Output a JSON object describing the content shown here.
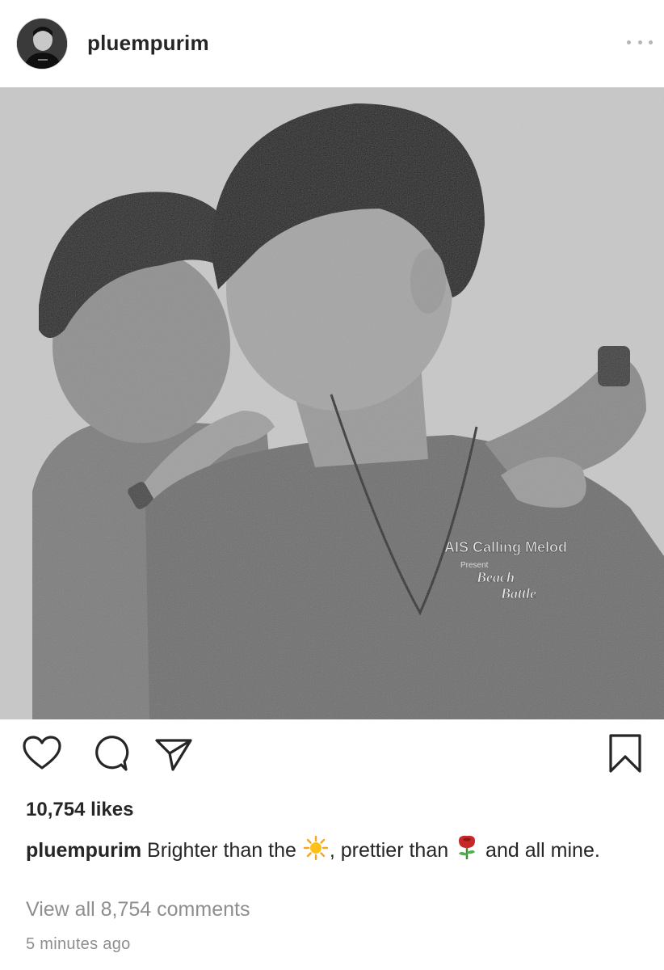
{
  "post": {
    "username": "pluempurim",
    "likes_text": "10,754 likes",
    "caption": {
      "username": "pluempurim",
      "part1": "Brighter than the",
      "emoji1": "sun-emoji",
      "part2": ", prettier than",
      "emoji2": "rose-emoji",
      "part3": "and all mine."
    },
    "view_comments_text": "View all 8,754 comments",
    "timestamp": "5 minutes ago",
    "photo_shirt_text": {
      "line1": "AIS Calling Melod",
      "line2": "Present",
      "line3": "Beach",
      "line4": "Battle"
    }
  },
  "icons": {
    "more": "more-options-icon",
    "like": "heart-icon",
    "comment": "comment-bubble-icon",
    "share": "paper-plane-icon",
    "save": "bookmark-icon"
  },
  "colors": {
    "text": "#262626",
    "muted": "#8e8e8e",
    "border": "#dbdbdb"
  }
}
